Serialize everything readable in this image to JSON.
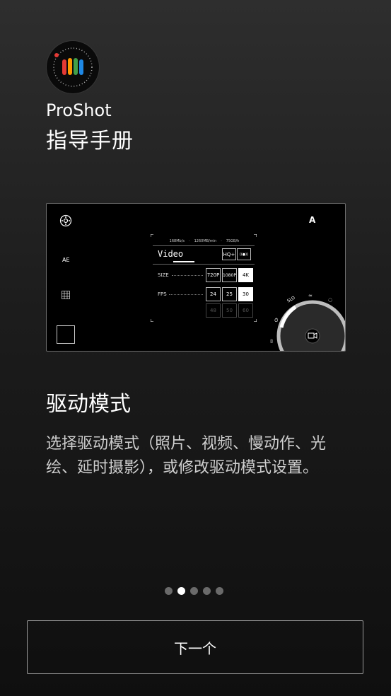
{
  "app": {
    "name": "ProShot",
    "subtitle": "指导手册"
  },
  "preview": {
    "left_controls": {
      "ae": "AE"
    },
    "top_right": "A",
    "panel": {
      "stats": [
        "168Mb/s",
        "·",
        "1260MB/min",
        "·",
        "75GB/h"
      ],
      "mode": "Video",
      "mode_buttons": [
        "HQ+",
        "((●))"
      ],
      "size_label": "SIZE",
      "size_options": [
        "720P",
        "1080P",
        "4K"
      ],
      "size_selected": "4K",
      "fps_label": "FPS",
      "fps_options_row1": [
        "24",
        "25",
        "30"
      ],
      "fps_selected": "30",
      "fps_options_row2": [
        "48",
        "50",
        "60"
      ]
    },
    "dial": {
      "label": "SLO"
    }
  },
  "section": {
    "title": "驱动模式",
    "description": "选择驱动模式（照片、视频、慢动作、光绘、延时摄影），或修改驱动模式设置。"
  },
  "pagination": {
    "total": 5,
    "active_index": 1
  },
  "next_button": {
    "label": "下一个"
  },
  "colors": {
    "logo_red": "#e53935",
    "logo_orange": "#ff9800",
    "logo_yellow": "#fdd835",
    "logo_green": "#43a047",
    "logo_blue": "#1e88e5"
  }
}
